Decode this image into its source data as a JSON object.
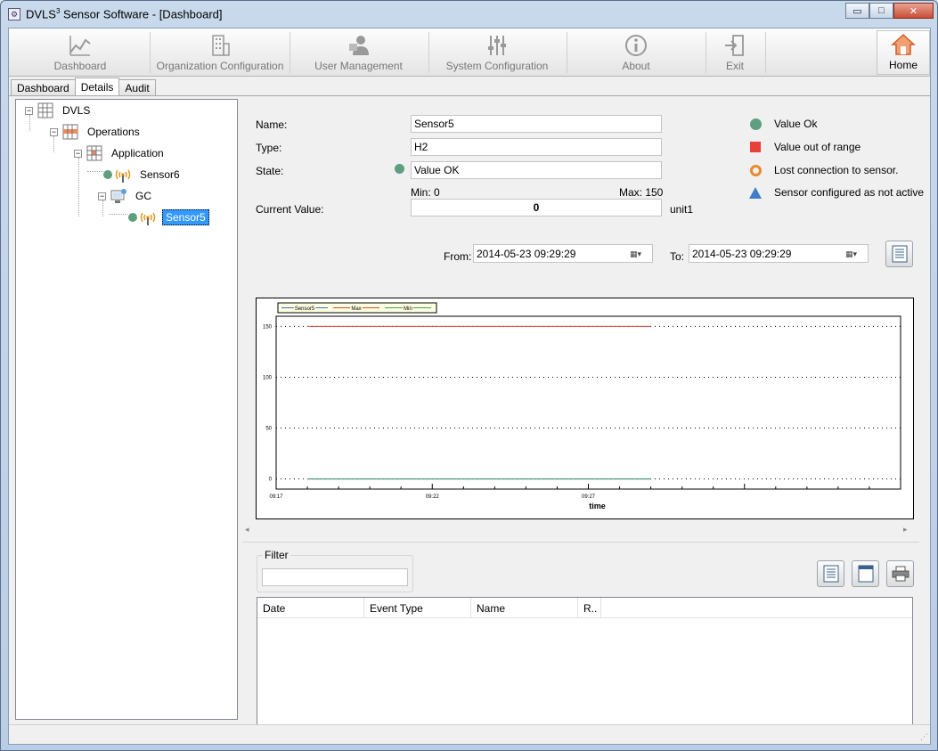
{
  "window": {
    "title_prefix": "DVLS",
    "title_sup": "3",
    "title_suffix": " Sensor Software - [Dashboard]",
    "controls": {
      "minimize": "▭",
      "maximize": "□",
      "close": "✕"
    }
  },
  "toolbar": {
    "items": [
      {
        "label": "Dashboard",
        "icon": "chart-icon"
      },
      {
        "label": "Organization Configuration",
        "icon": "building-icon"
      },
      {
        "label": "User Management",
        "icon": "users-icon"
      },
      {
        "label": "System Configuration",
        "icon": "sliders-icon"
      },
      {
        "label": "About",
        "icon": "info-icon"
      },
      {
        "label": "Exit",
        "icon": "exit-icon"
      },
      {
        "label": "Home",
        "icon": "home-icon"
      }
    ]
  },
  "tabs": [
    "Dashboard",
    "Details",
    "Audit"
  ],
  "tree": {
    "nodes": [
      {
        "label": "DVLS",
        "icon": "grid-icon",
        "expander": "−"
      },
      {
        "label": "Operations",
        "icon": "folder-grid-icon",
        "expander": "−"
      },
      {
        "label": "Application",
        "icon": "app-grid-icon",
        "expander": "−"
      },
      {
        "label": "Sensor6",
        "icon": "antenna-icon"
      },
      {
        "label": "GC",
        "icon": "gc-icon",
        "expander": "−"
      },
      {
        "label": "Sensor5",
        "icon": "antenna-icon",
        "selected": true
      }
    ]
  },
  "details": {
    "name_label": "Name:",
    "name_value": "Sensor5",
    "type_label": "Type:",
    "type_value": "H2",
    "state_label": "State:",
    "state_value": "Value OK",
    "min_text": "Min: 0",
    "max_text": "Max: 150",
    "current_label": "Current Value:",
    "current_value": "0",
    "unit": "unit1"
  },
  "legend": [
    {
      "label": "Value Ok",
      "symbol": "circle",
      "color": "#5f9e7f"
    },
    {
      "label": "Value out of range",
      "symbol": "square",
      "color": "#e8413a"
    },
    {
      "label": "Lost connection to sensor.",
      "symbol": "ring",
      "color": "#ea8a2e"
    },
    {
      "label": "Sensor configured as not active",
      "symbol": "triangle",
      "color": "#3f7fc8"
    }
  ],
  "range": {
    "from_label": "From:",
    "from_value": "2014-05-23 09:29:29",
    "to_label": "To:",
    "to_value": "2014-05-23 09:29:29"
  },
  "chart_data": {
    "type": "line",
    "xlabel": "time",
    "ylabel": "",
    "legend_placement": "top-left",
    "grid": true,
    "ylim": [
      -10,
      160
    ],
    "yticks": [
      0,
      50,
      100,
      150
    ],
    "xtick_labels": [
      "09:17",
      "09:22",
      "09:27"
    ],
    "series": [
      {
        "name": "Sensor5",
        "color": "#3b6fb6",
        "x": [
          "09:18",
          "09:29"
        ],
        "values": [
          0,
          0
        ]
      },
      {
        "name": "Max",
        "color": "#d9453a",
        "x": [
          "09:18",
          "09:29"
        ],
        "values": [
          150,
          150
        ]
      },
      {
        "name": "Min",
        "color": "#4a9a6a",
        "x": [
          "09:18",
          "09:29"
        ],
        "values": [
          0,
          0
        ]
      }
    ]
  },
  "filter": {
    "label": "Filter",
    "value": "",
    "placeholder": ""
  },
  "grid": {
    "columns": [
      "Date",
      "Event Type",
      "Name",
      "R.."
    ]
  },
  "colors": {
    "selection": "#3399ff",
    "ok_green": "#5f9e7f",
    "max_red": "#d9453a"
  }
}
